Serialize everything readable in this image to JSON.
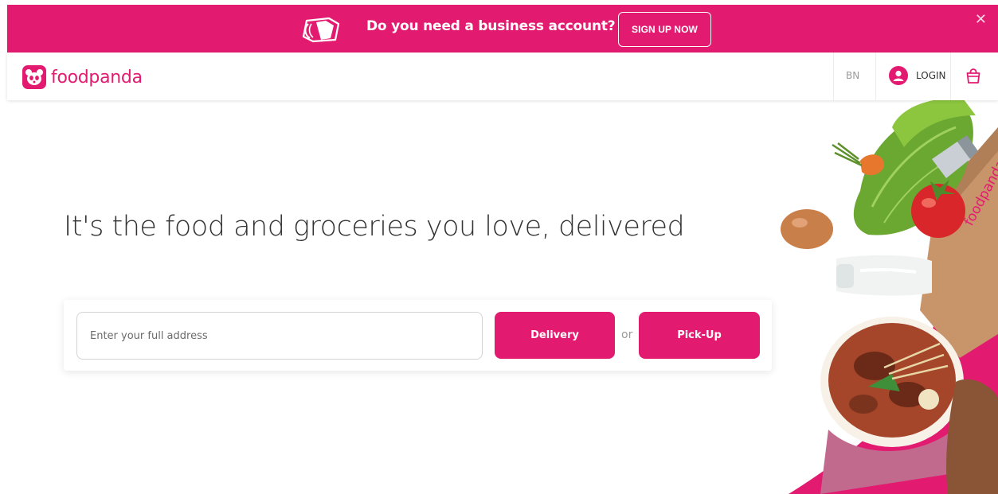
{
  "promo": {
    "text": "Do you need a business account?",
    "cta_label": "SIGN UP NOW",
    "close_glyph": "✕",
    "icon": "business-bag-icon",
    "background": "#e21b70"
  },
  "header": {
    "brand": "foodpanda",
    "logo_icon": "panda-logo-icon",
    "language": "BN",
    "login_label": "LOGIN",
    "login_icon": "user-avatar-icon",
    "cart_icon": "shopping-bag-icon"
  },
  "hero": {
    "headline": "It's the food and groceries you love, delivered"
  },
  "search": {
    "address_placeholder": "Enter your full address",
    "address_value": "",
    "delivery_label": "Delivery",
    "or_text": "or",
    "pickup_label": "Pick-Up"
  },
  "illustration": {
    "label": "foodpanda"
  },
  "colors": {
    "brand_pink": "#e21b70",
    "text_dark": "#333333",
    "muted": "#9a9a9a"
  }
}
